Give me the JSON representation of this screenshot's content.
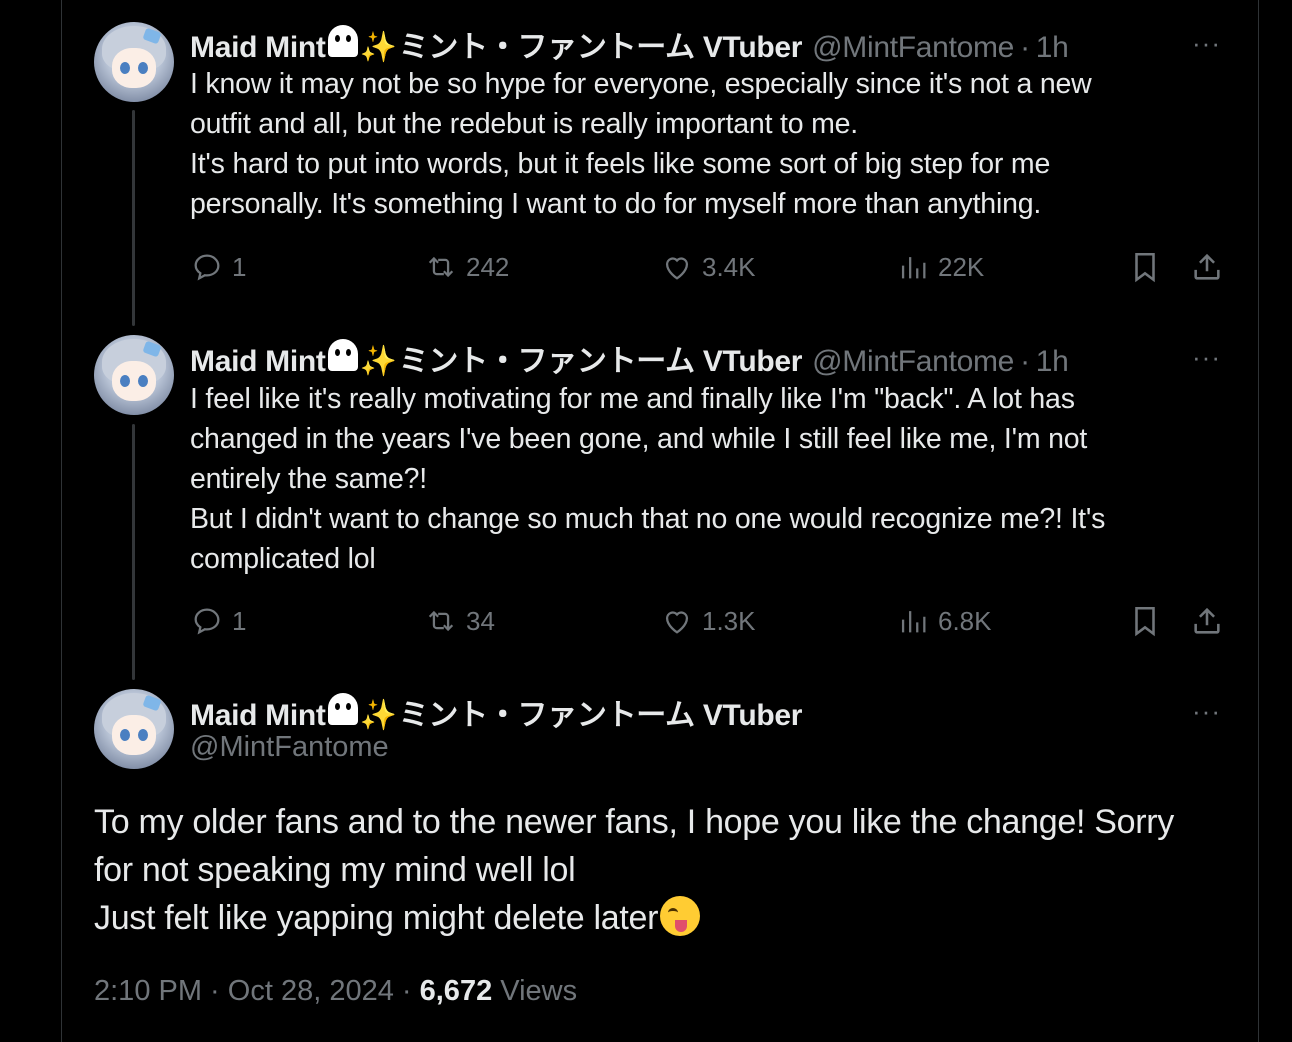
{
  "user": {
    "display_name": "Maid Mint",
    "emoji_ghost": "ghost-emoji",
    "sparkle": "✨",
    "name_suffix": "ミント・ファントーム VTuber",
    "handle": "@MintFantome",
    "dot": "·"
  },
  "tweets": [
    {
      "time": "1h",
      "lines": [
        "I know it may not be so hype for everyone, especially since it's not a new",
        "outfit and all, but the redebut is really important to me.",
        "It's hard to put into words, but it feels like some sort of big step for me",
        "personally. It's something I want to do for myself more than anything."
      ],
      "replies": "1",
      "reposts": "242",
      "likes": "3.4K",
      "views": "22K"
    },
    {
      "time": "1h",
      "lines": [
        "I feel like it's really motivating for me and finally like I'm \"back\". A lot has",
        "changed in the years I've been gone, and while I still feel like me, I'm not",
        "entirely the same?!",
        "But I didn't want to change so much that no one would recognize me?! It's",
        "complicated lol"
      ],
      "replies": "1",
      "reposts": "34",
      "likes": "1.3K",
      "views": "6.8K"
    }
  ],
  "main_tweet": {
    "lines": [
      "To my older fans and to the newer fans, I hope you like the change! Sorry",
      "for not speaking my mind well lol",
      "Just felt like yapping might delete later"
    ],
    "emoji": "zany-face-emoji",
    "timestamp": "2:10 PM · Oct 28, 2024",
    "meta_dot": "·",
    "view_count": "6,672",
    "views_label": "Views"
  },
  "icons": {
    "more": "···",
    "reply": "reply-icon",
    "repost": "repost-icon",
    "like": "heart-icon",
    "views": "analytics-icon",
    "bookmark": "bookmark-icon",
    "share": "share-icon"
  },
  "colors": {
    "background": "#000000",
    "text": "#e7e9ea",
    "muted": "#71767b",
    "border": "#2f3336"
  }
}
